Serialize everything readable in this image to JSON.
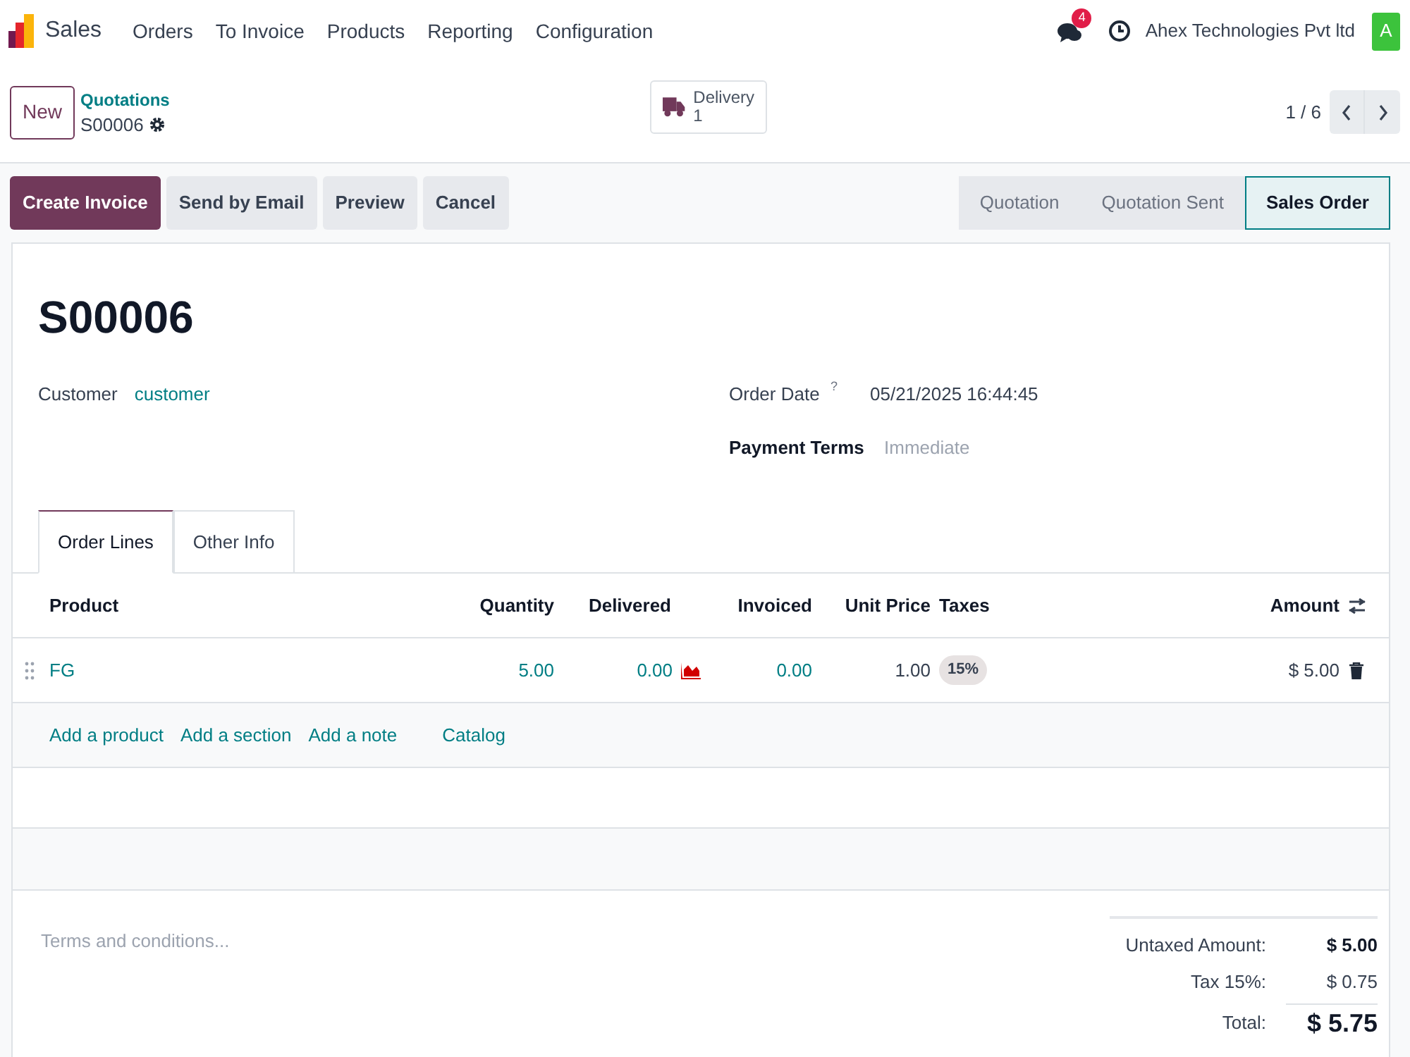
{
  "navbar": {
    "app": "Sales",
    "menus": [
      "Orders",
      "To Invoice",
      "Products",
      "Reporting",
      "Configuration"
    ],
    "messages_count": "4",
    "company": "Ahex Technologies Pvt ltd",
    "avatar": "A"
  },
  "control_panel": {
    "new_button": "New",
    "breadcrumb": "Quotations",
    "record": "S00006",
    "smart_button": {
      "label": "Delivery",
      "count": "1"
    },
    "pager": "1 / 6"
  },
  "actions": [
    {
      "label": "Create Invoice",
      "kind": "primary"
    },
    {
      "label": "Send by Email",
      "kind": "secondary"
    },
    {
      "label": "Preview",
      "kind": "secondary"
    },
    {
      "label": "Cancel",
      "kind": "secondary"
    }
  ],
  "statusbar": [
    {
      "label": "Quotation",
      "selected": false
    },
    {
      "label": "Quotation Sent",
      "selected": false
    },
    {
      "label": "Sales Order",
      "selected": true
    }
  ],
  "form": {
    "title": "S00006",
    "fields_left": [
      {
        "label": "Customer",
        "value": "customer",
        "kind": "link",
        "emphasized": false
      }
    ],
    "fields_right": [
      {
        "label": "Order Date",
        "help": "?",
        "value": "05/21/2025 16:44:45",
        "emphasized": false
      },
      {
        "label": "Payment Terms",
        "placeholder": "Immediate",
        "emphasized": true
      }
    ]
  },
  "tabs": [
    {
      "label": "Order Lines",
      "selected": true
    },
    {
      "label": "Other Info",
      "selected": false
    }
  ],
  "order_lines": {
    "columns": [
      "Product",
      "Quantity",
      "Delivered",
      "Invoiced",
      "Unit Price",
      "Taxes",
      "Amount"
    ],
    "rows": [
      {
        "product": "FG",
        "quantity": "5.00",
        "delivered": "0.00",
        "invoiced": "0.00",
        "unit_price": "1.00",
        "taxes": [
          "15%"
        ],
        "amount": "$ 5.00"
      }
    ],
    "add_links": [
      "Add a product",
      "Add a section",
      "Add a note",
      "Catalog"
    ]
  },
  "terms_placeholder": "Terms and conditions...",
  "totals": [
    {
      "label": "Untaxed Amount:",
      "value": "$ 5.00",
      "kind": "subtotal"
    },
    {
      "label": "Tax 15%:",
      "value": "$ 0.75",
      "kind": "tax"
    },
    {
      "label": "Total:",
      "value": "$ 5.75",
      "kind": "total"
    }
  ]
}
